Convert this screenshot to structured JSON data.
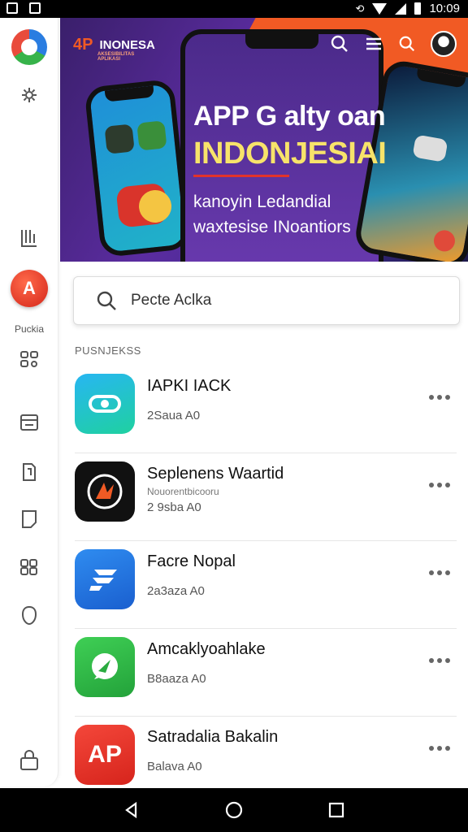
{
  "status_bar": {
    "time": "10:09"
  },
  "sidebar": {
    "label": "Puckia"
  },
  "banner": {
    "brand": "INONESA",
    "brand_sub": "AKSESIBILITAS APLIKASI",
    "title_line1": "APP G alty oan",
    "title_line2": "INDONJESIAI",
    "subtitle_line1": "kanoyin Ledandial",
    "subtitle_line2": "waxtesise INoantiors",
    "accent_color": "#f15a24"
  },
  "search": {
    "placeholder": "Pecte Aclka"
  },
  "section": {
    "label": "PUSNJEKSS"
  },
  "apps": [
    {
      "name": "IAPKI IACK",
      "sub": "",
      "meta": "2Saua A0",
      "icon": "link-icon",
      "icon_text": "",
      "color": "#1fb8c9"
    },
    {
      "name": "Seplenens Waartid",
      "sub": "Nouorentbicooru",
      "meta": "2 9sba A0",
      "icon": "bird-icon",
      "icon_text": "",
      "color": "#111111"
    },
    {
      "name": "Facre Nopal",
      "sub": "",
      "meta": "2a3aza A0",
      "icon": "f-logo-icon",
      "icon_text": "",
      "color": "#2a78e4"
    },
    {
      "name": "Amcaklyoahlake",
      "sub": "",
      "meta": "B8aaza A0",
      "icon": "chat-icon",
      "icon_text": "",
      "color": "#34b24a"
    },
    {
      "name": "Satradalia Bakalin",
      "sub": "",
      "meta": "Balava A0",
      "icon": "ap-logo-icon",
      "icon_text": "AP",
      "color": "#e8352a"
    }
  ]
}
